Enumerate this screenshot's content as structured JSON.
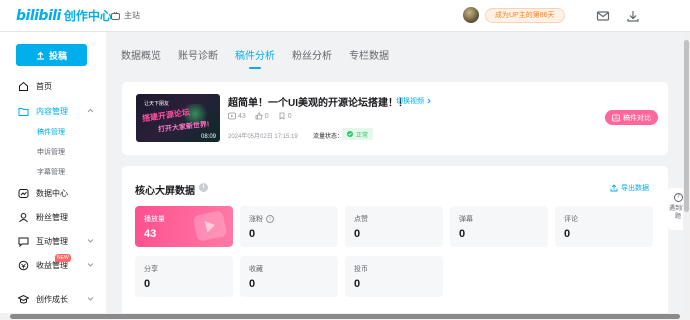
{
  "header": {
    "logo_text": "bilibili",
    "logo_sub": "创作中心",
    "home_label": "主站",
    "up_days": "成为UP主的第86天"
  },
  "sidebar": {
    "post_label": "投稿",
    "items": [
      {
        "label": "首页",
        "icon": "home-icon"
      },
      {
        "label": "内容管理",
        "icon": "folder-icon"
      },
      {
        "label": "数据中心",
        "icon": "chart-icon"
      },
      {
        "label": "粉丝管理",
        "icon": "user-icon"
      },
      {
        "label": "互动管理",
        "icon": "chat-icon"
      },
      {
        "label": "收益管理",
        "icon": "coin-icon"
      },
      {
        "label": "创作成长",
        "icon": "cap-icon"
      }
    ],
    "sub_items": [
      "稿件管理",
      "申诉管理",
      "字幕管理"
    ],
    "new_badge": "NEW"
  },
  "tabs": [
    "数据概览",
    "账号诊断",
    "稿件分析",
    "粉丝分析",
    "专栏数据"
  ],
  "video": {
    "title": "超简单！一个UI美观的开源论坛搭建！！",
    "switch_label": "切换视频",
    "views": "43",
    "likes": "0",
    "favorites": "0",
    "date": "2024年05月02日 17:15:19",
    "flow_label": "流量状态：",
    "flow_status": "正常",
    "compare_label": "稿件对比",
    "duration": "08:09",
    "thumb_line1": "让天下朋友",
    "thumb_line2": "搭建开源论坛",
    "thumb_line3": "打开大家新世界!"
  },
  "core": {
    "title": "核心大屏数据",
    "export_label": "导出数据",
    "metrics": [
      {
        "label": "播放量",
        "value": "43"
      },
      {
        "label": "涨粉",
        "value": "0"
      },
      {
        "label": "点赞",
        "value": "0"
      },
      {
        "label": "弹幕",
        "value": "0"
      },
      {
        "label": "评论",
        "value": "0"
      },
      {
        "label": "分享",
        "value": "0"
      },
      {
        "label": "收藏",
        "value": "0"
      },
      {
        "label": "投币",
        "value": "0"
      }
    ]
  },
  "help": {
    "label": "遇到问题"
  },
  "colors": {
    "accent": "#00aeec",
    "pink": "#ff6699",
    "ok": "#2ac864",
    "orange": "#ff7f24"
  }
}
